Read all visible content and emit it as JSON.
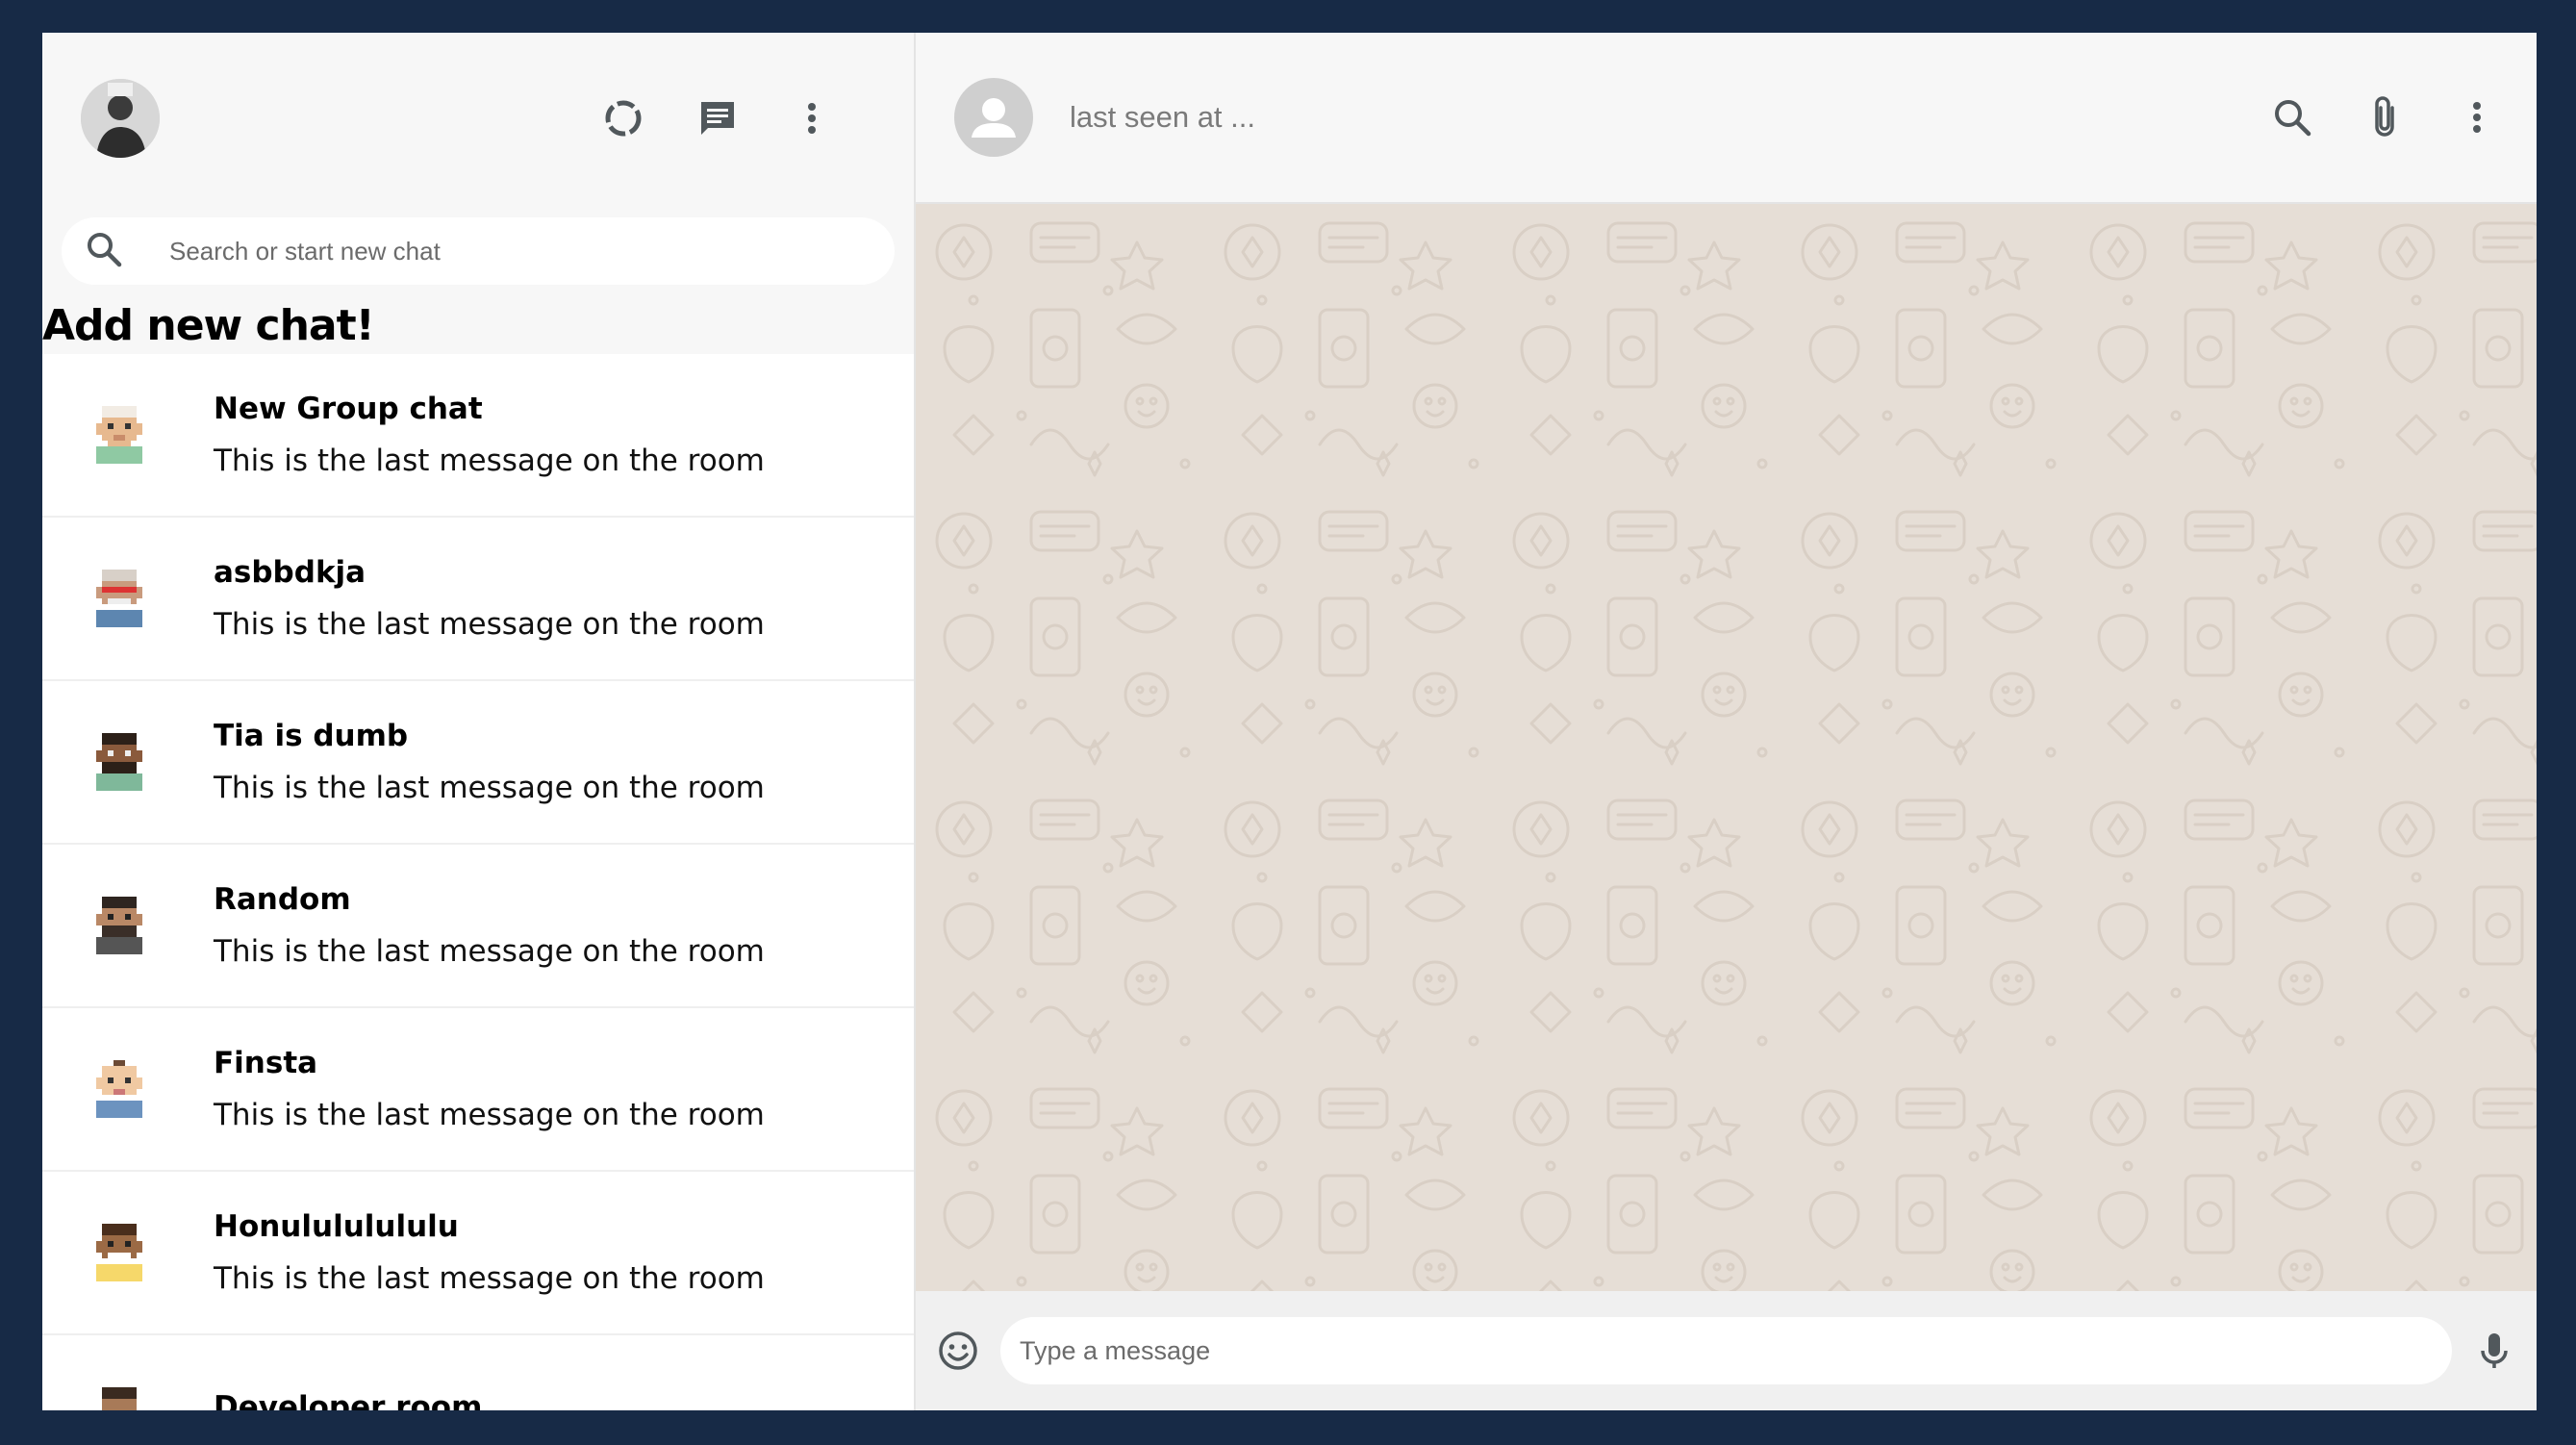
{
  "sidebar": {
    "header": {
      "avatar_icon": "user-avatar",
      "icons": [
        "status-icon",
        "new-chat-icon",
        "more-vert-icon"
      ]
    },
    "search": {
      "placeholder": "Search or start new chat",
      "value": ""
    },
    "add_new_chat_label": "Add new chat!",
    "chats": [
      {
        "name": "New Group chat",
        "last_message": "This is the last message on the room"
      },
      {
        "name": "asbbdkja",
        "last_message": "This is the last message on the room"
      },
      {
        "name": "Tia is dumb",
        "last_message": "This is the last message on the room"
      },
      {
        "name": "Random",
        "last_message": "This is the last message on the room"
      },
      {
        "name": "Finsta",
        "last_message": "This is the last message on the room"
      },
      {
        "name": "Honulululululu",
        "last_message": "This is the last message on the room"
      },
      {
        "name": "Developer room",
        "last_message": ""
      }
    ]
  },
  "chat": {
    "header": {
      "last_seen": "last seen at ...",
      "icons": [
        "search-icon",
        "attach-icon",
        "more-vert-icon"
      ]
    },
    "footer": {
      "placeholder": "Type a message",
      "value": "",
      "icons": [
        "emoji-icon",
        "mic-icon"
      ]
    }
  },
  "colors": {
    "background": "#172a46",
    "panel": "#f7f7f7",
    "chat_wallpaper": "#e6ded6",
    "icon": "#51585c"
  }
}
